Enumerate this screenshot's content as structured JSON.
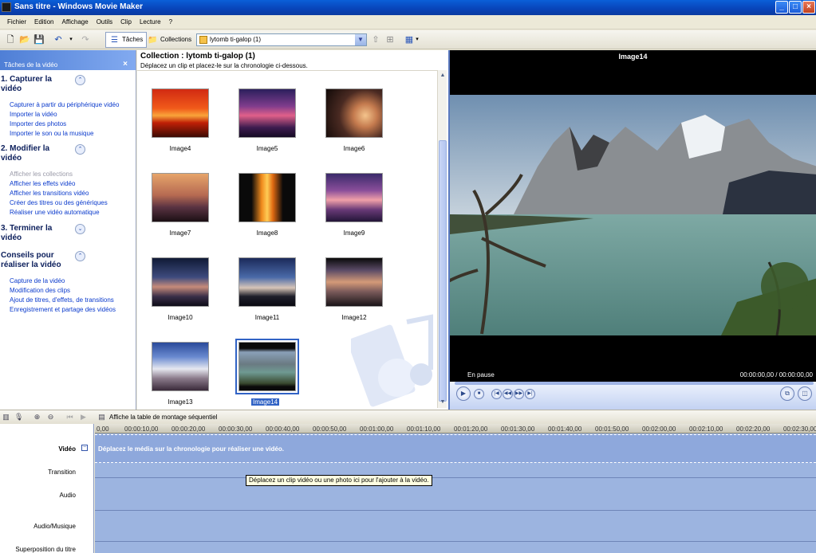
{
  "window": {
    "title": "Sans titre - Windows Movie Maker"
  },
  "menu": [
    "Fichier",
    "Edition",
    "Affichage",
    "Outils",
    "Clip",
    "Lecture",
    "?"
  ],
  "toolbar": {
    "tasks_label": "Tâches",
    "collections_label": "Collections",
    "collection_select": "lytomb ti-galop (1)"
  },
  "taskpane": {
    "header": "Tâches de la vidéo",
    "sections": [
      {
        "title": "1. Capturer la vidéo",
        "links": [
          "Capturer à partir du périphérique vidéo",
          "Importer la vidéo",
          "Importer des photos",
          "Importer le son ou la musique"
        ]
      },
      {
        "title": "2. Modifier la vidéo",
        "links": [
          "Afficher les collections",
          "Afficher les effets vidéo",
          "Afficher les transitions vidéo",
          "Créer des titres ou des génériques",
          "Réaliser une vidéo automatique"
        ]
      },
      {
        "title": "3. Terminer la vidéo",
        "links": []
      },
      {
        "title": "Conseils pour réaliser la vidéo",
        "links": [
          "Capture de la vidéo",
          "Modification des clips",
          "Ajout de titres, d'effets, de transitions",
          "Enregistrement et partage des vidéos"
        ]
      }
    ]
  },
  "collection": {
    "title": "Collection : lytomb ti-galop (1)",
    "subtitle": "Déplacez un clip et placez-le sur la chronologie ci-dessous.",
    "items": [
      "Image4",
      "Image5",
      "Image6",
      "Image7",
      "Image8",
      "Image9",
      "Image10",
      "Image11",
      "Image12",
      "Image13",
      "Image14"
    ],
    "selected": "Image14"
  },
  "preview": {
    "title": "Image14",
    "status": "En pause",
    "time": "00:00:00,00 / 00:00:00,00"
  },
  "storyboard": {
    "toggle_label": "Affiche la table de montage séquentiel"
  },
  "timeline": {
    "ruler": [
      "0,00",
      "00:00:10,00",
      "00:00:20,00",
      "00:00:30,00",
      "00:00:40,00",
      "00:00:50,00",
      "00:01:00,00",
      "00:01:10,00",
      "00:01:20,00",
      "00:01:30,00",
      "00:01:40,00",
      "00:01:50,00",
      "00:02:00,00",
      "00:02:10,00",
      "00:02:20,00",
      "00:02:30,00"
    ],
    "tracks": {
      "video": "Vidéo",
      "transition": "Transition",
      "audio": "Audio",
      "audio_music": "Audio/Musique",
      "title_overlay": "Superposition du titre"
    },
    "video_hint": "Déplacez le média sur la chronologie pour réaliser une vidéo.",
    "tooltip": "Déplacez un clip vidéo ou une photo ici pour l'ajouter à la vidéo."
  },
  "colors": {
    "title_bar": "#0843b8",
    "task_link": "#0a3acc",
    "timeline": "#9cb4e0",
    "selection": "#3163c5"
  }
}
